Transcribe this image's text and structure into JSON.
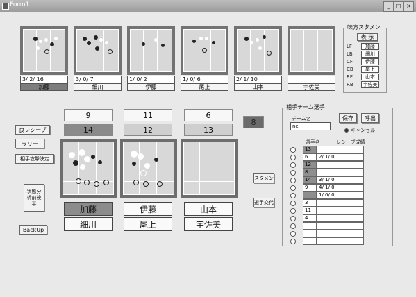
{
  "window": {
    "title": "Form1",
    "min_label": "_",
    "max_label": "□",
    "close_label": "×"
  },
  "top_players": [
    {
      "stat": "3/ 2/ 16",
      "name": "加藤",
      "dark": true
    },
    {
      "stat": "3/ 0/ 7",
      "name": "細川",
      "dark": false
    },
    {
      "stat": "1/ 0/ 2",
      "name": "伊藤",
      "dark": false
    },
    {
      "stat": "1/ 0/ 6",
      "name": "尾上",
      "dark": false
    },
    {
      "stat": "2/ 1/ 10",
      "name": "山本",
      "dark": false
    },
    {
      "stat": "",
      "name": "宇佐美",
      "dark": false
    }
  ],
  "ally_starting": {
    "title": "味方スタメン",
    "header": "表 示",
    "rows": [
      {
        "pos": "LF",
        "name": "加藤"
      },
      {
        "pos": "LB",
        "name": "細川"
      },
      {
        "pos": "CF",
        "name": "伊藤"
      },
      {
        "pos": "CB",
        "name": "尾上"
      },
      {
        "pos": "RF",
        "name": "山本"
      },
      {
        "pos": "RB",
        "name": "宇佐美"
      }
    ]
  },
  "left_buttons": {
    "good_receive": "良レシーブ",
    "rally": "ラリー",
    "opp_attack": "相手攻撃決定",
    "analysis": "状態分析前後半",
    "backup": "BackUp"
  },
  "numbers": {
    "col1_top": "9",
    "col1_bottom": "14",
    "col2_top": "11",
    "col2_bottom": "12",
    "col3_top": "6",
    "col3_bottom": "13",
    "side": "8"
  },
  "court_names": {
    "col1_top": "加藤",
    "col1_bottom": "細川",
    "col2_top": "伊藤",
    "col2_bottom": "尾上",
    "col3_top": "山本",
    "col3_bottom": "宇佐美"
  },
  "mid_buttons": {
    "stamen": "スタメン",
    "swap": "選手交代"
  },
  "opponent": {
    "title": "相手チーム選手",
    "team_label": "チーム名",
    "team_value": "ne",
    "save": "保存",
    "load": "呼出",
    "cancel": "キャンセル",
    "col_player": "選手名",
    "col_receive": "レシーブ成績",
    "rows": [
      {
        "num": "13",
        "rec": "",
        "hl": true
      },
      {
        "num": "6",
        "rec": "2/ 1/ 0",
        "hl": false
      },
      {
        "num": "12",
        "rec": "",
        "hl": true
      },
      {
        "num": "8",
        "rec": "",
        "hl": true
      },
      {
        "num": "14",
        "rec": "3/ 1/ 0",
        "hl": true
      },
      {
        "num": "9",
        "rec": "4/ 1/ 0",
        "hl": false
      },
      {
        "num": "",
        "rec": "1/ 0/ 0",
        "hl": true
      },
      {
        "num": "3",
        "rec": "",
        "hl": false
      },
      {
        "num": "11",
        "rec": "",
        "hl": false
      },
      {
        "num": "4",
        "rec": "",
        "hl": false
      },
      {
        "num": "",
        "rec": "",
        "hl": false
      },
      {
        "num": "",
        "rec": "",
        "hl": false
      },
      {
        "num": "",
        "rec": "",
        "hl": false
      }
    ]
  }
}
